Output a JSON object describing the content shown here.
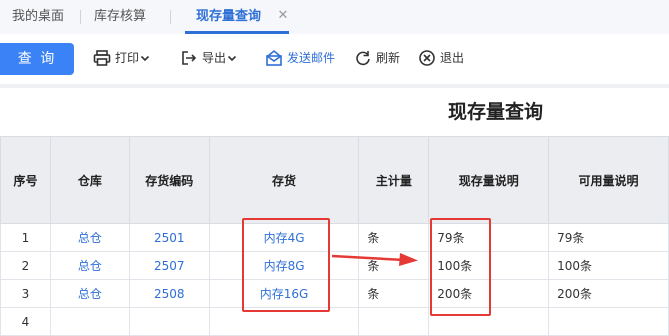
{
  "tabs": [
    {
      "label": "我的桌面"
    },
    {
      "label": "库存核算"
    },
    {
      "label": "现存量查询"
    }
  ],
  "toolbar": {
    "query_label": "查 询",
    "print_label": "打印",
    "export_label": "导出",
    "email_label": "发送邮件",
    "refresh_label": "刷新",
    "exit_label": "退出"
  },
  "report": {
    "title": "现存量查询"
  },
  "table": {
    "headers": [
      "序号",
      "仓库",
      "存货编码",
      "存货",
      "主计量",
      "现存量说明",
      "可用量说明"
    ],
    "rows": [
      {
        "no": "1",
        "warehouse": "总仓",
        "code": "2501",
        "item": "内存4G",
        "unit": "条",
        "onhand": "79条",
        "available": "79条"
      },
      {
        "no": "2",
        "warehouse": "总仓",
        "code": "2507",
        "item": "内存8G",
        "unit": "条",
        "onhand": "100条",
        "available": "100条"
      },
      {
        "no": "3",
        "warehouse": "总仓",
        "code": "2508",
        "item": "内存16G",
        "unit": "条",
        "onhand": "200条",
        "available": "200条"
      },
      {
        "no": "4",
        "warehouse": "",
        "code": "",
        "item": "",
        "unit": "",
        "onhand": "",
        "available": ""
      }
    ]
  },
  "colors": {
    "accent": "#2f6fd8",
    "query_button": "#3b82f6",
    "annotation_red": "#e53935"
  },
  "icons": [
    "printer-icon",
    "export-icon",
    "email-icon",
    "refresh-icon",
    "exit-icon",
    "close-icon",
    "chevron-down-icon"
  ]
}
